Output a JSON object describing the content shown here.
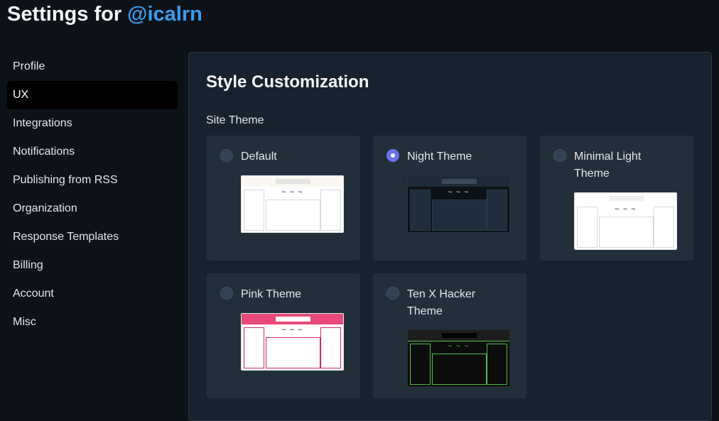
{
  "header": {
    "title_prefix": "Settings for ",
    "handle": "@icalrn"
  },
  "sidebar": {
    "items": [
      {
        "label": "Profile"
      },
      {
        "label": "UX",
        "active": true
      },
      {
        "label": "Integrations"
      },
      {
        "label": "Notifications"
      },
      {
        "label": "Publishing from RSS"
      },
      {
        "label": "Organization"
      },
      {
        "label": "Response Templates"
      },
      {
        "label": "Billing"
      },
      {
        "label": "Account"
      },
      {
        "label": "Misc"
      }
    ]
  },
  "panel": {
    "title": "Style Customization",
    "field_label": "Site Theme",
    "selected_theme": "Night Theme",
    "themes": [
      {
        "name": "Default",
        "checked": false,
        "preview": "default"
      },
      {
        "name": "Night Theme",
        "checked": true,
        "preview": "night"
      },
      {
        "name": "Minimal Light Theme",
        "checked": false,
        "preview": "minimal"
      },
      {
        "name": "Pink Theme",
        "checked": false,
        "preview": "pink"
      },
      {
        "name": "Ten X Hacker Theme",
        "checked": false,
        "preview": "hacker"
      }
    ],
    "preview_glyph": "~ ~ ~"
  },
  "colors": {
    "background": "#0d1219",
    "panel": "#18222e",
    "card": "#222f3b",
    "handle": "#3b9ded",
    "radio_checked": "#6a72f0"
  }
}
